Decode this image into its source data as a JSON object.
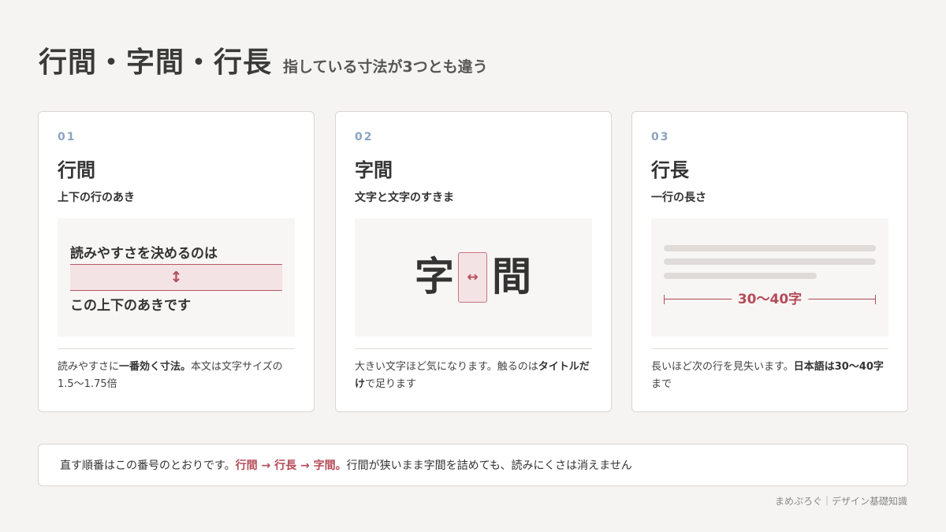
{
  "header": {
    "title": "行間・字間・行長",
    "subtitle": "指している寸法が3つとも違う"
  },
  "cards": [
    {
      "number": "01",
      "title": "行間",
      "subtitle": "上下の行のあき",
      "illustration": {
        "line1": "読みやすさを決めるのは",
        "arrow": "↕",
        "line2": "この上下のあきです"
      },
      "desc_pre": "読みやすさに",
      "desc_bold": "一番効く寸法。",
      "desc_post": "本文は文字サイズの1.5〜1.75倍"
    },
    {
      "number": "02",
      "title": "字間",
      "subtitle": "文字と文字のすきま",
      "illustration": {
        "left_char": "字",
        "arrow": "↔",
        "right_char": "間"
      },
      "desc_pre": "大きい文字ほど気になります。触るのは",
      "desc_bold": "タイトルだけ",
      "desc_post": "で足ります"
    },
    {
      "number": "03",
      "title": "行長",
      "subtitle": "一行の長さ",
      "illustration": {
        "measure_label": "30〜40字"
      },
      "desc_pre": "長いほど次の行を見失います。",
      "desc_bold": "日本語は30〜40字",
      "desc_post": "まで"
    }
  ],
  "footer": {
    "pre": "直す順番はこの番号のとおりです。",
    "accent": "行間 → 行長 → 字間。",
    "post": "行間が狭いまま字間を詰めても、読みにくさは消えません"
  },
  "credit": "まめぷろぐ｜デザイン基礎知識",
  "colors": {
    "accent": "#b54b59",
    "number": "#8aa4bf",
    "background": "#f5f4f2"
  }
}
